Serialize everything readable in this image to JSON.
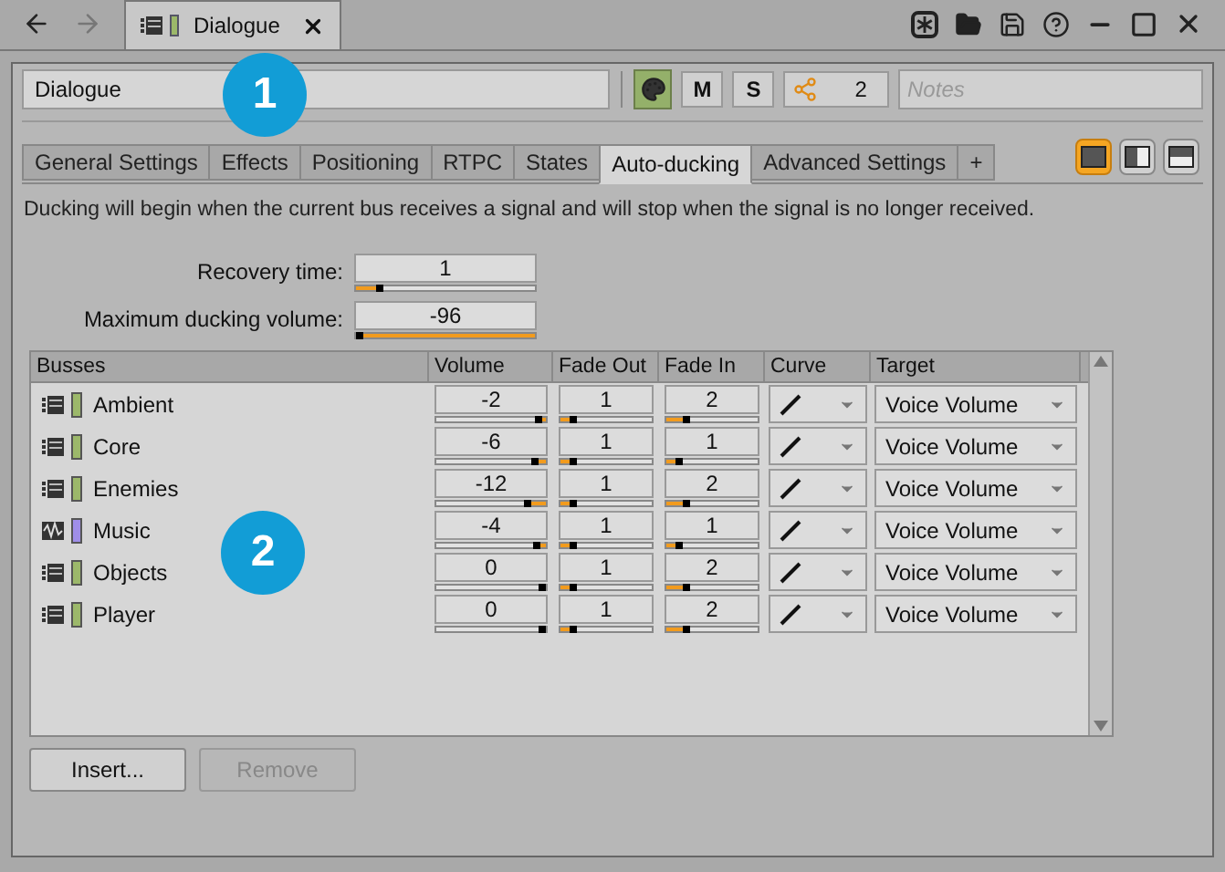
{
  "window": {
    "tab_title": "Dialogue"
  },
  "name_field": {
    "value": "Dialogue"
  },
  "toolbar": {
    "color_on": true,
    "mute": "M",
    "solo": "S",
    "references": "2",
    "notes_placeholder": "Notes"
  },
  "tabs": [
    {
      "label": "General Settings",
      "selected": false
    },
    {
      "label": "Effects",
      "selected": false
    },
    {
      "label": "Positioning",
      "selected": false
    },
    {
      "label": "RTPC",
      "selected": false
    },
    {
      "label": "States",
      "selected": false
    },
    {
      "label": "Auto-ducking",
      "selected": true
    },
    {
      "label": "Advanced Settings",
      "selected": false
    },
    {
      "label": "+",
      "selected": false
    }
  ],
  "layout_buttons": [
    {
      "kind": "single",
      "selected": true
    },
    {
      "kind": "split",
      "selected": false
    },
    {
      "kind": "stacked",
      "selected": false
    }
  ],
  "description": "Ducking will begin when the current bus receives a signal and will stop when the signal is no longer received.",
  "properties": [
    {
      "label": "Recovery time:",
      "kind": "time",
      "value": "1",
      "level": 0.12
    },
    {
      "label": "Maximum ducking volume:",
      "kind": "volume",
      "value": "-96",
      "level": 0.0
    }
  ],
  "table": {
    "columns": [
      "Busses",
      "Volume",
      "Fade Out",
      "Fade In",
      "Curve",
      "Target"
    ],
    "rows": [
      {
        "name": "Ambient",
        "kind": "bus",
        "color": "#9cb86a",
        "volume": {
          "value": "-2",
          "level": 0.97
        },
        "fade_out": {
          "value": "1",
          "level": 0.1
        },
        "fade_in": {
          "value": "2",
          "level": 0.2
        },
        "target": "Voice Volume"
      },
      {
        "name": "Core",
        "kind": "bus",
        "color": "#9cb86a",
        "volume": {
          "value": "-6",
          "level": 0.92
        },
        "fade_out": {
          "value": "1",
          "level": 0.1
        },
        "fade_in": {
          "value": "1",
          "level": 0.1
        },
        "target": "Voice Volume"
      },
      {
        "name": "Enemies",
        "kind": "bus",
        "color": "#9cb86a",
        "volume": {
          "value": "-12",
          "level": 0.85
        },
        "fade_out": {
          "value": "1",
          "level": 0.1
        },
        "fade_in": {
          "value": "2",
          "level": 0.2
        },
        "target": "Voice Volume"
      },
      {
        "name": "Music",
        "kind": "wave",
        "color": "#9f8ee8",
        "volume": {
          "value": "-4",
          "level": 0.95
        },
        "fade_out": {
          "value": "1",
          "level": 0.1
        },
        "fade_in": {
          "value": "1",
          "level": 0.1
        },
        "target": "Voice Volume"
      },
      {
        "name": "Objects",
        "kind": "bus",
        "color": "#9cb86a",
        "volume": {
          "value": "0",
          "level": 1.0
        },
        "fade_out": {
          "value": "1",
          "level": 0.1
        },
        "fade_in": {
          "value": "2",
          "level": 0.2
        },
        "target": "Voice Volume"
      },
      {
        "name": "Player",
        "kind": "bus",
        "color": "#9cb86a",
        "volume": {
          "value": "0",
          "level": 1.0
        },
        "fade_out": {
          "value": "1",
          "level": 0.1
        },
        "fade_in": {
          "value": "2",
          "level": 0.2
        },
        "target": "Voice Volume"
      }
    ]
  },
  "buttons": [
    {
      "label": "Insert...",
      "disabled": false
    },
    {
      "label": "Remove",
      "disabled": true
    }
  ],
  "callouts": [
    "1",
    "2"
  ]
}
